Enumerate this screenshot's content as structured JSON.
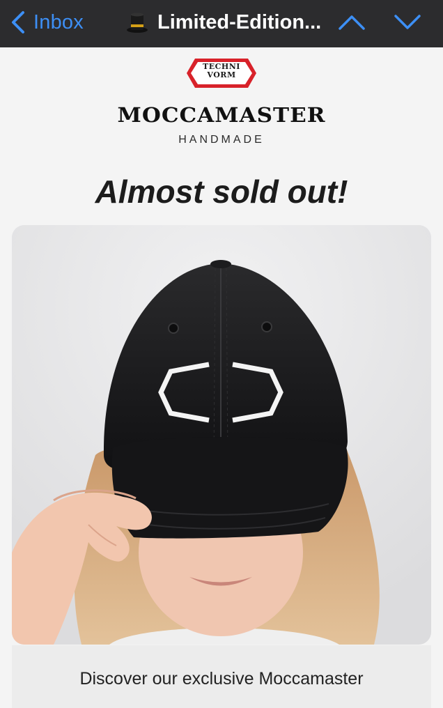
{
  "nav": {
    "back_label": "Inbox",
    "back_icon": "chevron-left-icon",
    "subject_icon": "top-hat-icon",
    "subject": "Limited-Edition...",
    "prev_icon": "chevron-up-icon",
    "next_icon": "chevron-down-icon",
    "accent": "#3d8ff5"
  },
  "email": {
    "badge_line1": "TECHNI",
    "badge_line2": "VORM",
    "brand_name": "MOCCAMASTER",
    "brand_tagline": "HANDMADE",
    "headline": "Almost sold out!",
    "hero_image": "black-cap-with-white-logo-photo",
    "description": "Discover our exclusive Moccamaster"
  }
}
